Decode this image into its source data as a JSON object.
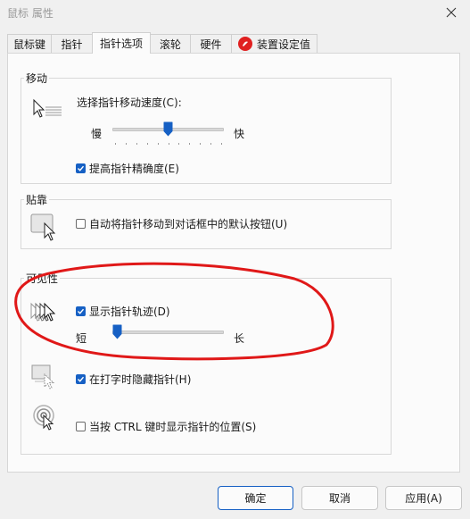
{
  "window": {
    "title": "鼠标 属性"
  },
  "tabs": [
    "鼠标键",
    "指针",
    "指针选项",
    "滚轮",
    "硬件",
    "装置设定值"
  ],
  "motion": {
    "title": "移动",
    "speed_label": "选择指针移动速度(C):",
    "slow": "慢",
    "fast": "快",
    "speed_level": 0.5,
    "precision_label": "提高指针精确度(E)",
    "precision_checked": true
  },
  "snap": {
    "title": "贴靠",
    "label": "自动将指针移动到对话框中的默认按钮(U)",
    "checked": false
  },
  "visibility": {
    "title": "可见性",
    "trails_label": "显示指针轨迹(D)",
    "trails_checked": true,
    "short": "短",
    "long": "长",
    "trail_level": 0.0,
    "hide_label": "在打字时隐藏指针(H)",
    "hide_checked": true,
    "ctrl_label": "当按 CTRL 键时显示指针的位置(S)",
    "ctrl_checked": false
  },
  "buttons": {
    "ok": "确定",
    "cancel": "取消",
    "apply": "应用(A)"
  },
  "colors": {
    "accent": "#1660c4",
    "annotation": "#e01818"
  }
}
